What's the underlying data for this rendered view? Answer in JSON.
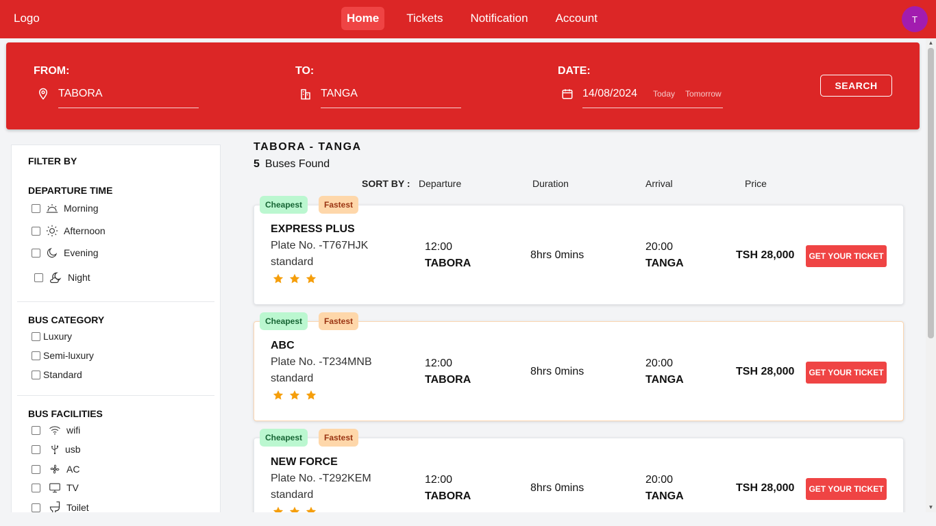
{
  "nav": {
    "logo": "Logo",
    "items": [
      {
        "label": "Home",
        "active": true
      },
      {
        "label": "Tickets",
        "active": false
      },
      {
        "label": "Notification",
        "active": false
      },
      {
        "label": "Account",
        "active": false
      }
    ],
    "avatar_initial": "T"
  },
  "search": {
    "from_label": "FROM:",
    "from_value": "TABORA",
    "to_label": "TO:",
    "to_value": "TANGA",
    "date_label": "DATE:",
    "date_value": "14/08/2024",
    "today_label": "Today",
    "tomorrow_label": "Tomorrow",
    "button_label": "SEARCH"
  },
  "filter": {
    "title": "FILTER BY",
    "departure_title": "DEPARTURE TIME",
    "departure_options": [
      "Morning",
      "Afternoon",
      "Evening",
      "Night"
    ],
    "category_title": "BUS CATEGORY",
    "category_options": [
      "Luxury",
      "Semi-luxury",
      "Standard"
    ],
    "facilities_title": "BUS FACILITIES",
    "facility_options": [
      "wifi",
      "usb",
      "AC",
      "TV",
      "Toilet"
    ]
  },
  "results": {
    "route": "TABORA - TANGA",
    "count": "5",
    "count_label": "Buses Found",
    "sort_label": "SORT BY :",
    "sort_options": [
      "Departure",
      "Duration",
      "Arrival",
      "Price"
    ],
    "cards": [
      {
        "badge_cheap": "Cheapest",
        "badge_fast": "Fastest",
        "name": "EXPRESS PLUS",
        "plate": "Plate No. -T767HJK",
        "category": "standard",
        "rating": 3,
        "dep_time": "12:00",
        "dep_city": "TABORA",
        "duration": "8hrs 0mins",
        "arr_time": "20:00",
        "arr_city": "TANGA",
        "price": "TSH 28,000",
        "button": "GET YOUR TICKET"
      },
      {
        "badge_cheap": "Cheapest",
        "badge_fast": "Fastest",
        "name": "ABC",
        "plate": "Plate No. -T234MNB",
        "category": "standard",
        "rating": 3,
        "dep_time": "12:00",
        "dep_city": "TABORA",
        "duration": "8hrs 0mins",
        "arr_time": "20:00",
        "arr_city": "TANGA",
        "price": "TSH 28,000",
        "button": "GET YOUR TICKET"
      },
      {
        "badge_cheap": "Cheapest",
        "badge_fast": "Fastest",
        "name": "NEW FORCE",
        "plate": "Plate No. -T292KEM",
        "category": "standard",
        "rating": 3,
        "dep_time": "12:00",
        "dep_city": "TABORA",
        "duration": "8hrs 0mins",
        "arr_time": "20:00",
        "arr_city": "TANGA",
        "price": "TSH 28,000",
        "button": "GET YOUR TICKET"
      }
    ]
  },
  "colors": {
    "brand_red": "#dc2626",
    "button_red": "#ef4444",
    "star": "#f59e0b",
    "avatar": "#a21caf"
  }
}
